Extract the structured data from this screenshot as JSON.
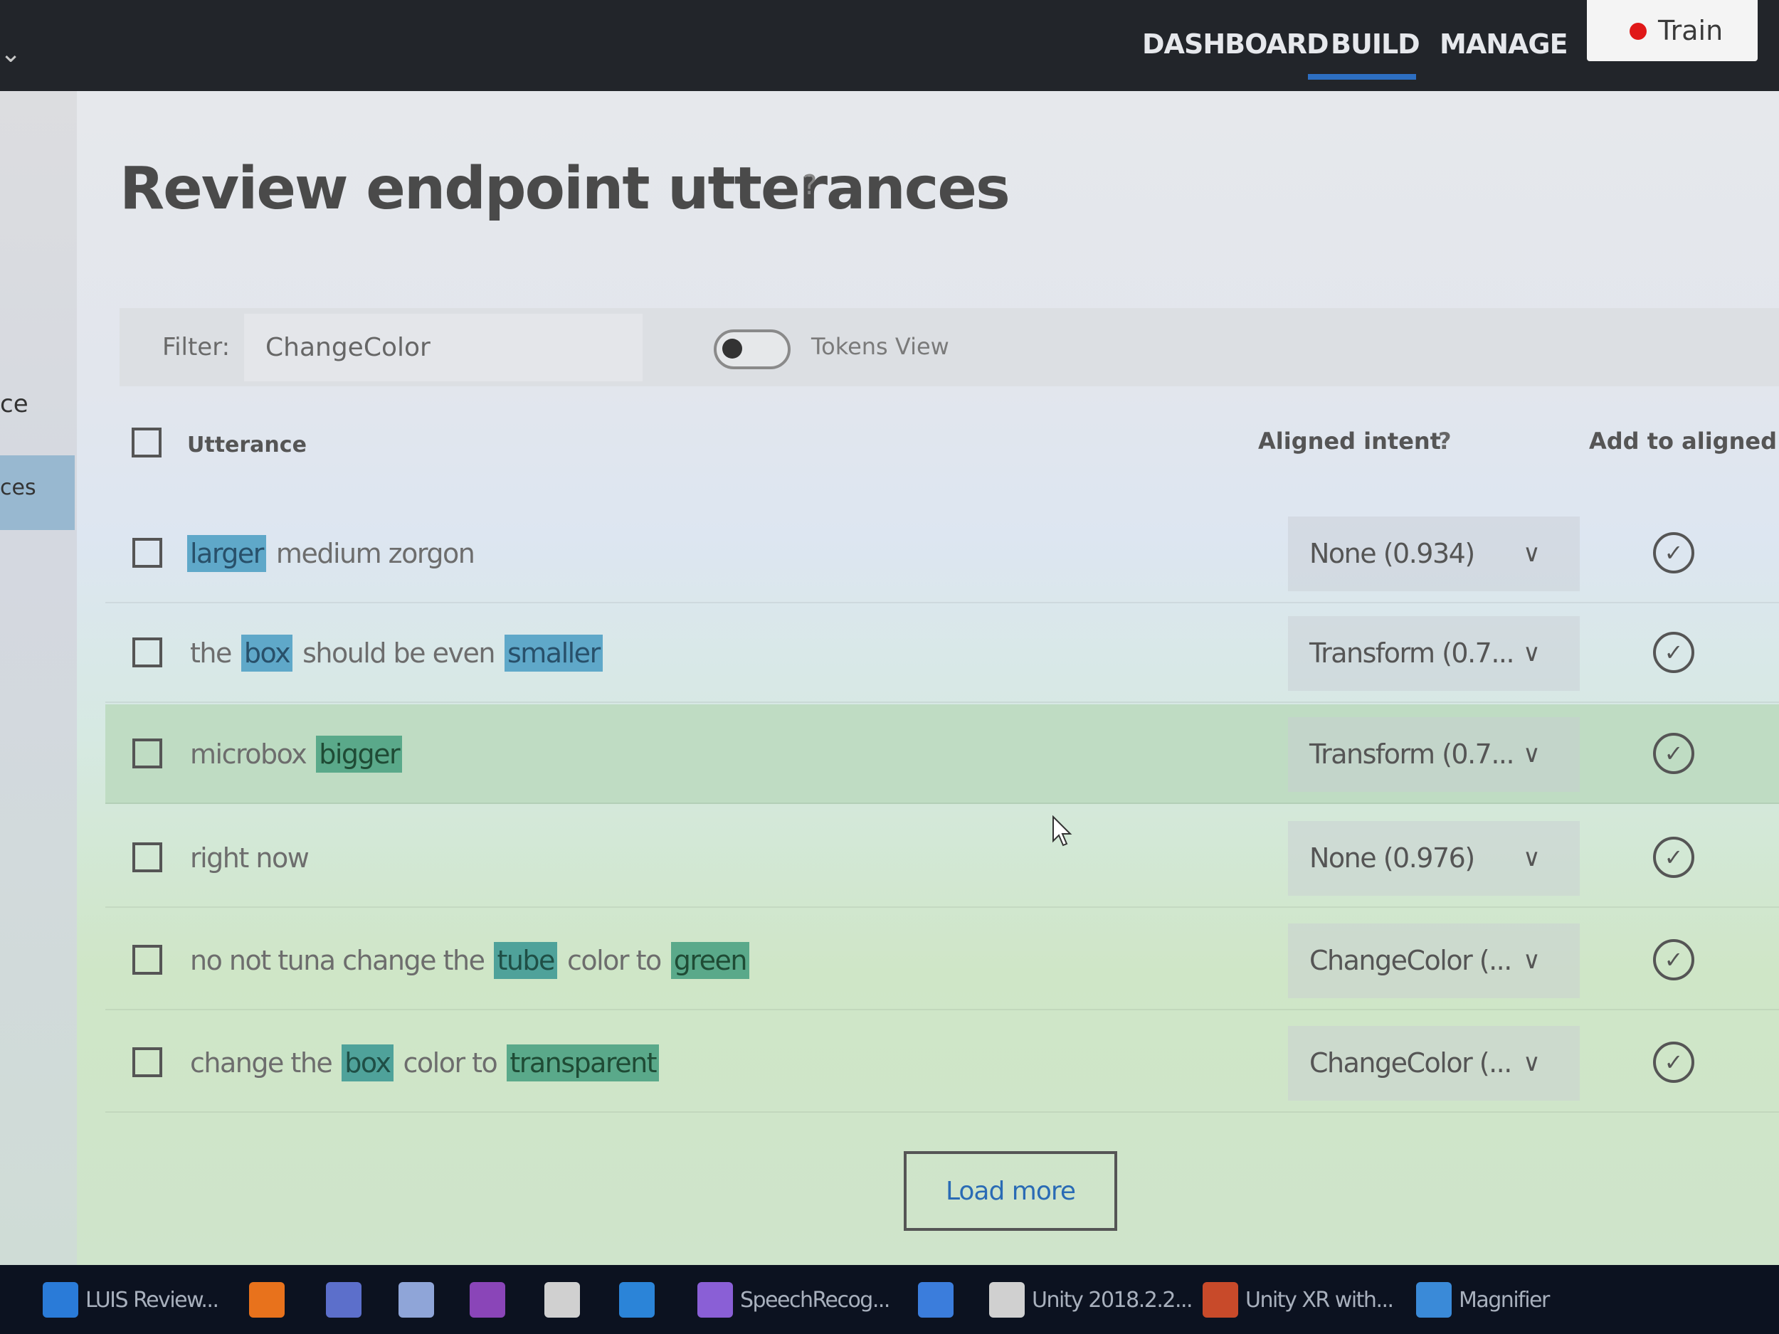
{
  "nav": {
    "dashboard": "DASHBOARD",
    "build": "BUILD",
    "manage": "MANAGE",
    "train": "Train",
    "active": "BUILD"
  },
  "sidebar": {
    "item_a": "ce",
    "item_b": "ces"
  },
  "page": {
    "title": "Review endpoint utterances",
    "title_help": "?"
  },
  "filter": {
    "label": "Filter:",
    "value": "ChangeColor",
    "tokens_view_label": "Tokens View",
    "tokens_view_on": false
  },
  "table": {
    "headers": {
      "utterance": "Utterance",
      "aligned_intent": "Aligned intent",
      "aligned_intent_help": "?",
      "add": "Add to aligned intent"
    },
    "rows": [
      {
        "tokens": [
          {
            "text": "larger",
            "entity": "blue"
          },
          {
            "text": "medium zorgon",
            "entity": null
          }
        ],
        "intent": "None (0.934)"
      },
      {
        "tokens": [
          {
            "text": "the",
            "entity": null
          },
          {
            "text": "box",
            "entity": "blue"
          },
          {
            "text": "should be even",
            "entity": null
          },
          {
            "text": "smaller",
            "entity": "blue"
          }
        ],
        "intent": "Transform (0.7..."
      },
      {
        "tokens": [
          {
            "text": "microbox",
            "entity": null
          },
          {
            "text": "bigger",
            "entity": "green"
          }
        ],
        "intent": "Transform (0.7..."
      },
      {
        "tokens": [
          {
            "text": "right now",
            "entity": null
          }
        ],
        "intent": "None (0.976)"
      },
      {
        "tokens": [
          {
            "text": "no not tuna change the",
            "entity": null
          },
          {
            "text": "tube",
            "entity": "teal"
          },
          {
            "text": "color to",
            "entity": null
          },
          {
            "text": "green",
            "entity": "green"
          }
        ],
        "intent": "ChangeColor (..."
      },
      {
        "tokens": [
          {
            "text": "change the",
            "entity": null
          },
          {
            "text": "box",
            "entity": "teal"
          },
          {
            "text": "color to",
            "entity": null
          },
          {
            "text": "transparent",
            "entity": "green"
          }
        ],
        "intent": "ChangeColor (..."
      }
    ]
  },
  "load_more": "Load more",
  "taskbar": [
    {
      "label": "LUIS Review...",
      "icon": "edge-icon",
      "color": "#2a7bd8"
    },
    {
      "label": "",
      "icon": "firefox-icon",
      "color": "#e8721c"
    },
    {
      "label": "",
      "icon": "teams-icon",
      "color": "#5c6fcb"
    },
    {
      "label": "",
      "icon": "app-icon",
      "color": "#8fa5d8"
    },
    {
      "label": "",
      "icon": "onenote-icon",
      "color": "#8a45b8"
    },
    {
      "label": "",
      "icon": "back-icon",
      "color": "#d0d0d0"
    },
    {
      "label": "",
      "icon": "vscode-icon",
      "color": "#2b84d8"
    },
    {
      "label": "SpeechRecog...",
      "icon": "visualstudio-icon",
      "color": "#8a5fd6"
    },
    {
      "label": "",
      "icon": "maps-icon",
      "color": "#3b7ddc"
    },
    {
      "label": "Unity 2018.2.2...",
      "icon": "unity-icon",
      "color": "#d0d0d0"
    },
    {
      "label": "Unity XR with...",
      "icon": "powerpoint-icon",
      "color": "#c84a2a"
    },
    {
      "label": "Magnifier",
      "icon": "magnifier-icon",
      "color": "#3a8ad8"
    }
  ]
}
